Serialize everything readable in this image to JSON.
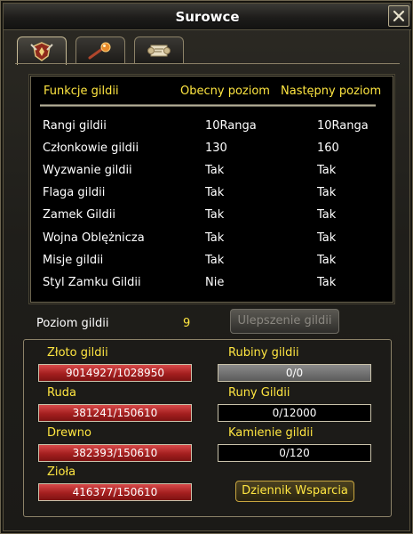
{
  "window": {
    "title": "Surowce"
  },
  "tabs": [
    {
      "icon": "guild-emblem-icon"
    },
    {
      "icon": "orb-wand-icon"
    },
    {
      "icon": "scroll-icon"
    }
  ],
  "features": {
    "headers": {
      "feature": "Funkcje gildii",
      "current": "Obecny poziom",
      "next": "Następny poziom"
    },
    "rows": [
      {
        "name": "Rangi gildii",
        "current": "10Ranga",
        "next": "10Ranga"
      },
      {
        "name": "Członkowie gildii",
        "current": "130",
        "next": "160"
      },
      {
        "name": "Wyzwanie gildii",
        "current": "Tak",
        "next": "Tak"
      },
      {
        "name": "Flaga gildii",
        "current": "Tak",
        "next": "Tak"
      },
      {
        "name": "Zamek Gildii",
        "current": "Tak",
        "next": "Tak"
      },
      {
        "name": "Wojna Oblężnicza",
        "current": "Tak",
        "next": "Tak"
      },
      {
        "name": "Misje gildii",
        "current": "Tak",
        "next": "Tak"
      },
      {
        "name": "Styl Zamku Gildii",
        "current": "Nie",
        "next": "Tak"
      }
    ]
  },
  "level": {
    "label": "Poziom gildii",
    "value": "9",
    "upgrade_label": "Ulepszenie gildii"
  },
  "resources": {
    "gold": {
      "label": "Złoto gildii",
      "value": "9014927/1028950"
    },
    "ore": {
      "label": "Ruda",
      "value": "381241/150610"
    },
    "wood": {
      "label": "Drewno",
      "value": "382393/150610"
    },
    "herbs": {
      "label": "Zioła",
      "value": "416377/150610"
    },
    "rubies": {
      "label": "Rubiny gildii",
      "value": "0/0"
    },
    "runes": {
      "label": "Runy Gildii",
      "value": "0/12000"
    },
    "stones": {
      "label": "Kamienie gildii",
      "value": "0/120"
    },
    "support_label": "Dziennik Wsparcia"
  },
  "colors": {
    "accent": "#ffe641",
    "bar_red": "#a41f1f",
    "bar_grey": "#6e6e6e"
  }
}
